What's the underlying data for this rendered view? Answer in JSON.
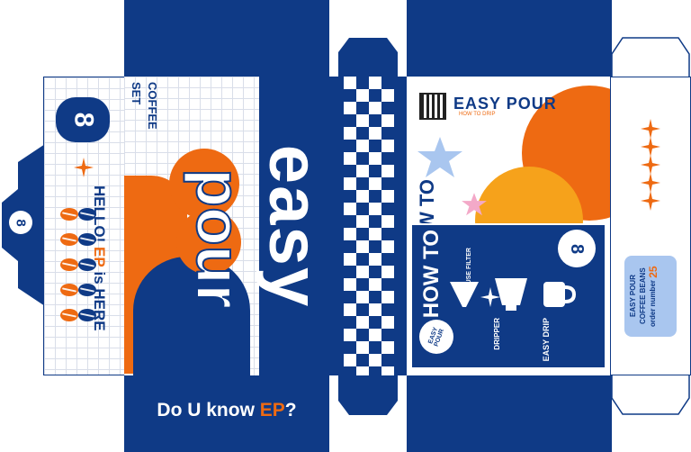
{
  "colors": {
    "navy": "#0f3a86",
    "orange": "#ee6a12",
    "light_orange": "#f6a21b",
    "light_blue": "#a9c6ef",
    "pink": "#f3a9c8",
    "white": "#ffffff"
  },
  "left_flap": {
    "badge_text": "8"
  },
  "left_side_panel": {
    "logo_text": "8",
    "headline_part1": "HELLO!",
    "headline_brand": "EP",
    "headline_part2": "is HERE"
  },
  "front_panel": {
    "coffee_set_label_1": "COFFEE",
    "coffee_set_label_2": "SET",
    "big_title_1": "easy",
    "big_title_2": "pour",
    "tagline_prefix": "Do U know",
    "tagline_brand": "EP",
    "tagline_suffix": "?"
  },
  "right_panel": {
    "brand_name": "EASY POUR",
    "brand_sub": "HOW TO DRIP",
    "how_to_big": "HOW TO",
    "card_title": "HOW TO",
    "card_badge": "8",
    "step1_label": "USE FILTER",
    "step2_label": "DRIPPER",
    "step3_label": "EASY DRIP",
    "card_logo": "EASY POUR"
  },
  "side_label": {
    "line1": "EASY POUR",
    "line2": "COFFEE BEANS",
    "line3": "order number",
    "order_number": "25"
  },
  "icons": [
    "qr-code-icon",
    "star-icon",
    "sparkle-icon",
    "coffee-bean-icon",
    "dripper-icon",
    "mug-icon",
    "filter-icon"
  ]
}
